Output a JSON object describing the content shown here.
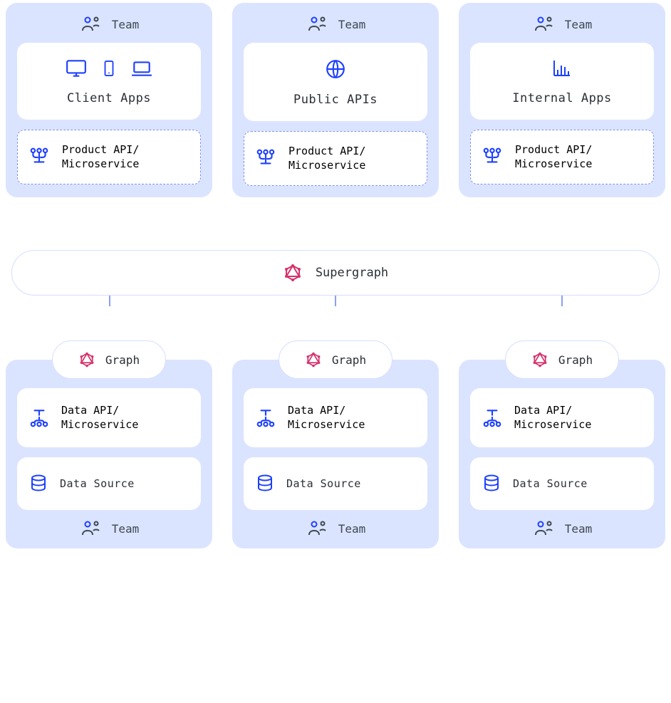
{
  "colors": {
    "card_bg": "#DBE4FF",
    "accent_blue": "#1e40ff",
    "accent_pink": "#d6336c",
    "connector": "#8ca0f5"
  },
  "top_teams": [
    {
      "team_label": "Team",
      "app_title": "Client Apps",
      "app_icons": [
        "monitor-icon",
        "phone-icon",
        "laptop-icon"
      ],
      "api_label": "Product API/\nMicroservice"
    },
    {
      "team_label": "Team",
      "app_title": "Public APIs",
      "app_icons": [
        "globe-icon"
      ],
      "api_label": "Product API/\nMicroservice"
    },
    {
      "team_label": "Team",
      "app_title": "Internal Apps",
      "app_icons": [
        "bar-chart-icon"
      ],
      "api_label": "Product API/\nMicroservice"
    }
  ],
  "supergraph": {
    "label": "Supergraph"
  },
  "bottom_teams": [
    {
      "graph_label": "Graph",
      "data_api_label": "Data API/\nMicroservice",
      "data_source_label": "Data Source",
      "team_label": "Team"
    },
    {
      "graph_label": "Graph",
      "data_api_label": "Data API/\nMicroservice",
      "data_source_label": "Data Source",
      "team_label": "Team"
    },
    {
      "graph_label": "Graph",
      "data_api_label": "Data API/\nMicroservice",
      "data_source_label": "Data Source",
      "team_label": "Team"
    }
  ]
}
